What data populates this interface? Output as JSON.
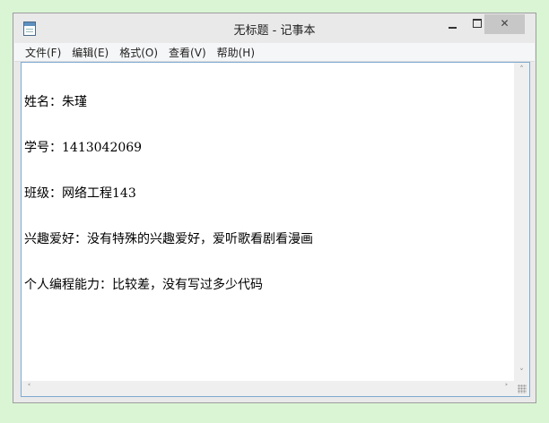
{
  "window": {
    "title": "无标题 - 记事本",
    "buttons": {
      "minimize": "",
      "maximize": "",
      "close": "✕"
    }
  },
  "menu": {
    "items": [
      {
        "label": "文件(F)"
      },
      {
        "label": "编辑(E)"
      },
      {
        "label": "格式(O)"
      },
      {
        "label": "查看(V)"
      },
      {
        "label": "帮助(H)"
      }
    ]
  },
  "document": {
    "lines": [
      "姓名：朱瑾",
      "学号：1413042069",
      "班级：网络工程143",
      "兴趣爱好：没有特殊的兴趣爱好，爱听歌看剧看漫画",
      "个人编程能力：比较差，没有写过多少代码"
    ]
  },
  "scrollbars": {
    "up_arrow": "˄",
    "down_arrow": "˅",
    "left_arrow": "˂",
    "right_arrow": "˃"
  },
  "colors": {
    "desktop": "#d9f5d4",
    "close_button": "#c7c7c7"
  }
}
